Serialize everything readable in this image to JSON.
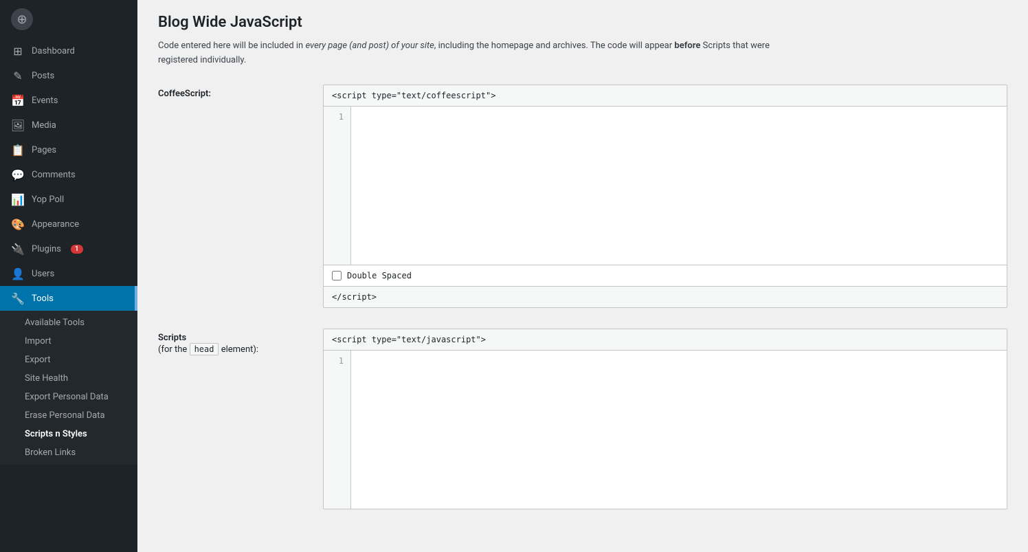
{
  "sidebar": {
    "items": [
      {
        "id": "dashboard",
        "label": "Dashboard",
        "icon": "⊞"
      },
      {
        "id": "posts",
        "label": "Posts",
        "icon": "📄"
      },
      {
        "id": "events",
        "label": "Events",
        "icon": "📅"
      },
      {
        "id": "media",
        "label": "Media",
        "icon": "🖼"
      },
      {
        "id": "pages",
        "label": "Pages",
        "icon": "📋"
      },
      {
        "id": "comments",
        "label": "Comments",
        "icon": "💬"
      },
      {
        "id": "yop-poll",
        "label": "Yop Poll",
        "icon": "📊"
      },
      {
        "id": "appearance",
        "label": "Appearance",
        "icon": "🎨"
      },
      {
        "id": "plugins",
        "label": "Plugins",
        "icon": "🔌",
        "badge": "1"
      },
      {
        "id": "users",
        "label": "Users",
        "icon": "👤"
      },
      {
        "id": "tools",
        "label": "Tools",
        "icon": "🔧",
        "active": true
      }
    ],
    "sub_items": [
      {
        "id": "available-tools",
        "label": "Available Tools"
      },
      {
        "id": "import",
        "label": "Import"
      },
      {
        "id": "export",
        "label": "Export"
      },
      {
        "id": "site-health",
        "label": "Site Health"
      },
      {
        "id": "export-personal-data",
        "label": "Export Personal Data"
      },
      {
        "id": "erase-personal-data",
        "label": "Erase Personal Data"
      },
      {
        "id": "scripts-n-styles",
        "label": "Scripts n Styles",
        "active": true
      },
      {
        "id": "broken-links",
        "label": "Broken Links"
      }
    ]
  },
  "page": {
    "title": "Blog Wide JavaScript",
    "description_plain": "Code entered here will be included in ",
    "description_italic": "every page (and post) of your site",
    "description_mid": ", including the homepage and archives. The code will appear ",
    "description_bold": "before",
    "description_end": " Scripts that were registered individually."
  },
  "coffeescript": {
    "label": "CoffeeScript:",
    "header": "<script type=\"text/coffeescript\">",
    "line_number": "1",
    "checkbox_label": "Double Spaced",
    "footer": "</script>"
  },
  "scripts_head": {
    "label_line1": "Scripts",
    "label_line2": "(for the",
    "label_head": "head",
    "label_line3": "element):",
    "header": "<script type=\"text/javascript\">",
    "line_number": "1"
  },
  "icons": {
    "dashboard": "⊞",
    "posts": "✎",
    "events": "📅",
    "media": "🖼",
    "pages": "📋",
    "comments": "💬",
    "yop-poll": "📊",
    "appearance": "🎨",
    "plugins": "🔌",
    "users": "👤",
    "tools": "🔧"
  }
}
